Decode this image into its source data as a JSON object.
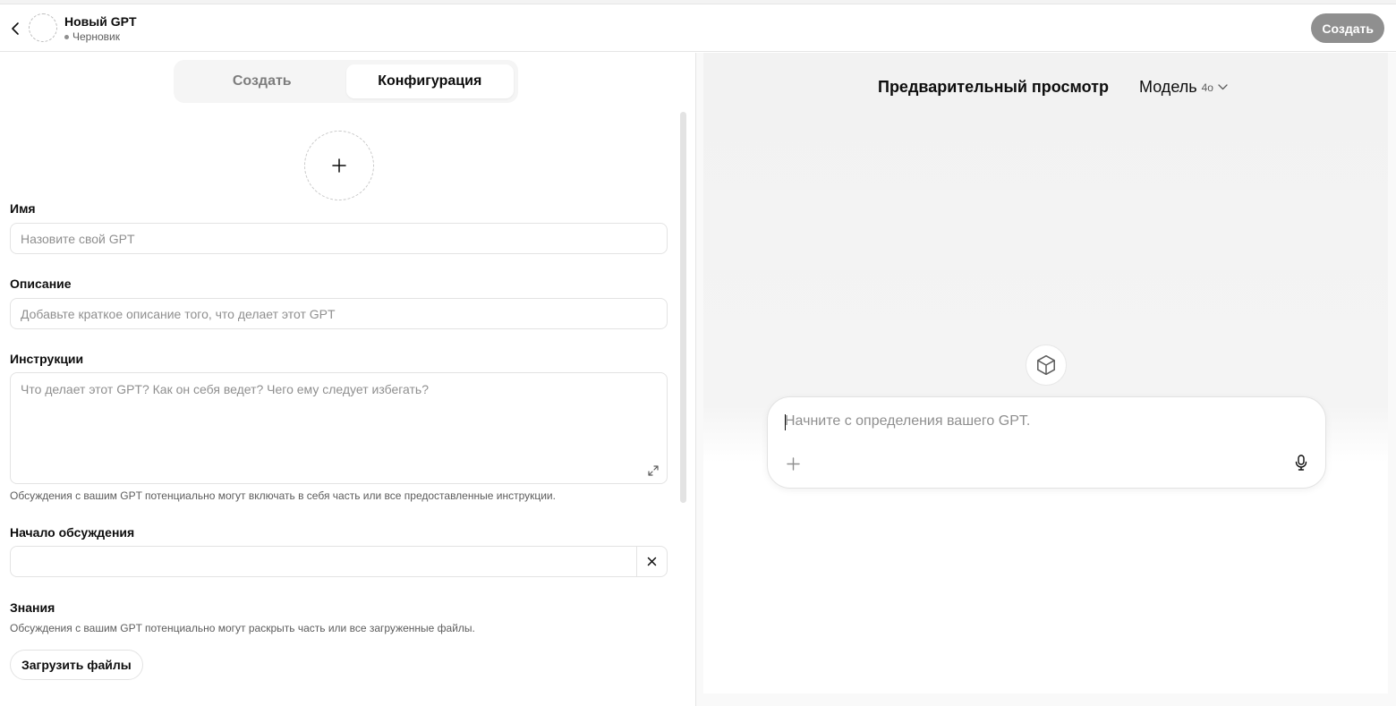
{
  "header": {
    "title": "Новый GPT",
    "status": "Черновик",
    "create_label": "Создать"
  },
  "tabs": [
    {
      "label": "Создать",
      "active": false
    },
    {
      "label": "Конфигурация",
      "active": true
    }
  ],
  "form": {
    "name_label": "Имя",
    "name_placeholder": "Назовите свой GPT",
    "description_label": "Описание",
    "description_placeholder": "Добавьте краткое описание того, что делает этот GPT",
    "instructions_label": "Инструкции",
    "instructions_placeholder": "Что делает этот GPT? Как он себя ведет? Чего ему следует избегать?",
    "instructions_hint": "Обсуждения с вашим GPT потенциально могут включать в себя часть или все предоставленные инструкции.",
    "starters_label": "Начало обсуждения",
    "knowledge_label": "Знания",
    "knowledge_hint": "Обсуждения с вашим GPT потенциально могут раскрыть часть или все загруженные файлы.",
    "upload_label": "Загрузить файлы"
  },
  "preview": {
    "title": "Предварительный просмотр",
    "model_label": "Модель",
    "model_version": "4o",
    "composer_placeholder": "Начните с определения вашего GPT."
  },
  "colors": {
    "accent_button": "#8f8f8f",
    "text": "#0d0d0d",
    "muted_text": "#5d5d5d"
  }
}
